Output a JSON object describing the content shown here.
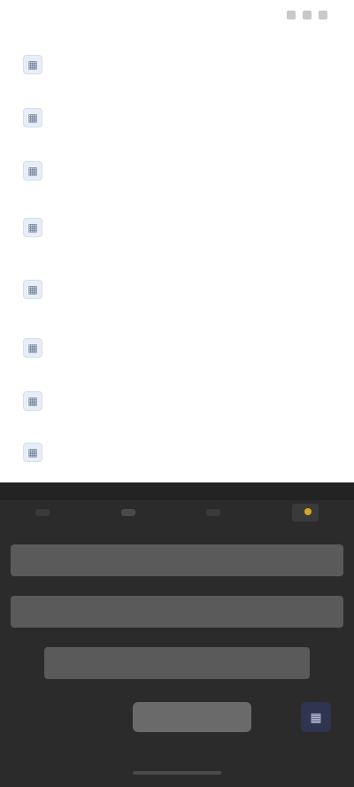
{
  "status": {
    "left": "",
    "right": ""
  },
  "list": {
    "rows": [
      {
        "icon": "app-icon",
        "title": "",
        "sub": "",
        "meta": ""
      },
      {
        "icon": "app-icon",
        "title": "",
        "sub": "",
        "meta": ""
      },
      {
        "icon": "app-icon",
        "title": "",
        "sub": "",
        "meta": ""
      },
      {
        "icon": "app-icon",
        "title": "",
        "sub": "",
        "meta": ""
      },
      {
        "icon": "app-icon",
        "title": "",
        "sub": "",
        "meta": ""
      },
      {
        "icon": "app-icon",
        "title": "",
        "sub": "",
        "meta": ""
      },
      {
        "icon": "app-icon",
        "title": "",
        "sub": "",
        "meta": ""
      },
      {
        "icon": "app-icon",
        "title": "",
        "sub": "",
        "meta": ""
      }
    ]
  },
  "sheet": {
    "tabs": [
      "",
      "",
      "",
      ""
    ],
    "panels": [
      "",
      "",
      ""
    ],
    "cta": "",
    "corner_icon": "grid-icon"
  },
  "colors": {
    "sheet_bg": "#2b2b2b",
    "accent_gold": "#d4a62a",
    "corner_blue": "#2f3550"
  }
}
